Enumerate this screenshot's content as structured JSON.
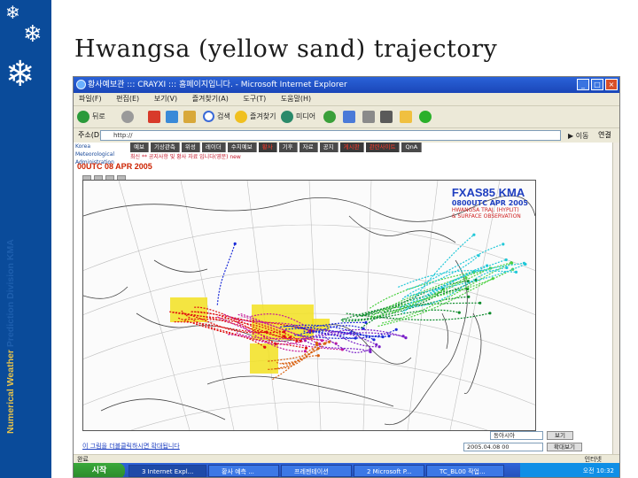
{
  "slide": {
    "title": "Hwangsa (yellow sand) trajectory",
    "side_text_a": "Numerical ",
    "side_text_b": "Weather",
    "side_text_c": " Prediction Division  KMA",
    "colors": {
      "sidebar": "#0a4b9a",
      "side_accent": "#e8c34a"
    }
  },
  "browser": {
    "window_title": "황사예보관 ::: CRAYXI ::: 홈페이지입니다. - Microsoft Internet Explorer",
    "menu": [
      "파일(F)",
      "편집(E)",
      "보기(V)",
      "즐겨찾기(A)",
      "도구(T)",
      "도움말(H)"
    ],
    "toolbar": {
      "back": "뒤로",
      "search": "검색",
      "favorites": "즐겨찾기",
      "media": "미디어"
    },
    "address_label": "주소(D)",
    "address_value": "http://",
    "go_label": "이동",
    "links_label": "연결",
    "status_left": "완료",
    "status_zone": "인터넷"
  },
  "kma_page": {
    "logo": "Korea Meteorological Administration",
    "nav": [
      "예보",
      "기상관측",
      "위성",
      "레이더",
      "수치예보",
      "황사",
      "기후",
      "자료",
      "공지",
      "게시판",
      "관련사이트",
      "QnA"
    ],
    "subnav": "최신 ** 공지사항 및 황사 자료 입니다(영문) new",
    "map_header": "00UTC 08 APR 2005",
    "map_title": "FXAS85 KMA",
    "map_subtitle": "0800UTC APR 2005",
    "map_note_1": "HWANGSA TRAJ. (HYPLIT)",
    "map_note_2": "& SURFACE OBSERVATION",
    "link_text": "이 그림을 더블클릭하시면 확대됩니다",
    "select_1": "동아시아",
    "select_2": "2005.04.08 00",
    "button_1": "보기",
    "button_2": "확대보기"
  },
  "taskbar": {
    "start": "시작",
    "items": [
      "3 Internet Expl...",
      "황사 예측 ...",
      "프레젠테이션",
      "2 Microsoft P...",
      "TC_BL00 작업..."
    ],
    "tray_time": "오전 10:32"
  },
  "trajectory_colors": {
    "red": "#e01010",
    "magenta": "#c8189a",
    "blue": "#1a2ad8",
    "purple": "#7a20c8",
    "green": "#0a8a2a",
    "lime": "#4ad040",
    "cyan": "#20c8d8",
    "orange": "#d86010",
    "yellow_dust_area": "#f2e020"
  }
}
